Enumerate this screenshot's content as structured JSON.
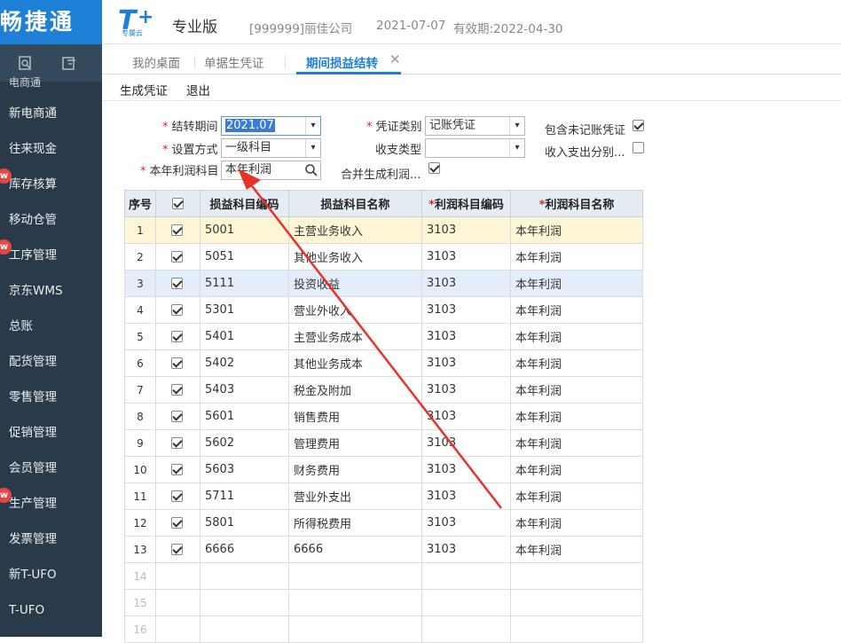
{
  "sidebar": {
    "logo": "畅捷通",
    "cut_item": "电商通",
    "items": [
      {
        "label": "新电商通",
        "badge": ""
      },
      {
        "label": "往来现金",
        "badge": ""
      },
      {
        "label": "库存核算",
        "badge": "w"
      },
      {
        "label": "移动仓管",
        "badge": ""
      },
      {
        "label": "工序管理",
        "badge": "w"
      },
      {
        "label": "京东WMS",
        "badge": ""
      },
      {
        "label": "总账",
        "badge": ""
      },
      {
        "label": "配货管理",
        "badge": ""
      },
      {
        "label": "零售管理",
        "badge": ""
      },
      {
        "label": "促销管理",
        "badge": ""
      },
      {
        "label": "会员管理",
        "badge": ""
      },
      {
        "label": "生产管理",
        "badge": "w"
      },
      {
        "label": "发票管理",
        "badge": ""
      },
      {
        "label": "新T-UFO",
        "badge": ""
      },
      {
        "label": "T-UFO",
        "badge": ""
      }
    ]
  },
  "header": {
    "brand_sub": "专属云",
    "brand_name": "专业版",
    "company": "[999999]丽佳公司",
    "date": "2021-07-07",
    "expire": "有效期:2022-04-30"
  },
  "tabs": [
    {
      "label": "我的桌面"
    },
    {
      "label": "单据生凭证"
    },
    {
      "label": "期间损益结转"
    }
  ],
  "toolbar": {
    "generate": "生成凭证",
    "exit": "退出"
  },
  "form": {
    "period_label": "结转期间",
    "period_value": "2021.07",
    "method_label": "设置方式",
    "method_value": "一级科目",
    "profit_label": "本年利润科目",
    "profit_value": "本年利润",
    "voucher_type_label": "凭证类别",
    "voucher_type_value": "记账凭证",
    "revenue_type_label": "收支类型",
    "revenue_type_value": "",
    "include_unposted_label": "包含未记账凭证",
    "include_unposted": true,
    "split_label": "收入支出分别...",
    "split": false,
    "merge_label": "合并生成利润...",
    "merge": true
  },
  "grid": {
    "headers": [
      "序号",
      "",
      "损益科目编码",
      "损益科目名称",
      "利润科目编码",
      "利润科目名称"
    ],
    "rows": [
      {
        "no": "1",
        "checked": true,
        "code": "5001",
        "name": "主营业务收入",
        "pcode": "3103",
        "pname": "本年利润"
      },
      {
        "no": "2",
        "checked": true,
        "code": "5051",
        "name": "其他业务收入",
        "pcode": "3103",
        "pname": "本年利润"
      },
      {
        "no": "3",
        "checked": true,
        "code": "5111",
        "name": "投资收益",
        "pcode": "3103",
        "pname": "本年利润"
      },
      {
        "no": "4",
        "checked": true,
        "code": "5301",
        "name": "营业外收入",
        "pcode": "3103",
        "pname": "本年利润"
      },
      {
        "no": "5",
        "checked": true,
        "code": "5401",
        "name": "主营业务成本",
        "pcode": "3103",
        "pname": "本年利润"
      },
      {
        "no": "6",
        "checked": true,
        "code": "5402",
        "name": "其他业务成本",
        "pcode": "3103",
        "pname": "本年利润"
      },
      {
        "no": "7",
        "checked": true,
        "code": "5403",
        "name": "税金及附加",
        "pcode": "3103",
        "pname": "本年利润"
      },
      {
        "no": "8",
        "checked": true,
        "code": "5601",
        "name": "销售费用",
        "pcode": "3103",
        "pname": "本年利润"
      },
      {
        "no": "9",
        "checked": true,
        "code": "5602",
        "name": "管理费用",
        "pcode": "3103",
        "pname": "本年利润"
      },
      {
        "no": "10",
        "checked": true,
        "code": "5603",
        "name": "财务费用",
        "pcode": "3103",
        "pname": "本年利润"
      },
      {
        "no": "11",
        "checked": true,
        "code": "5711",
        "name": "营业外支出",
        "pcode": "3103",
        "pname": "本年利润"
      },
      {
        "no": "12",
        "checked": true,
        "code": "5801",
        "name": "所得税费用",
        "pcode": "3103",
        "pname": "本年利润"
      },
      {
        "no": "13",
        "checked": true,
        "code": "6666",
        "name": "6666",
        "pcode": "3103",
        "pname": "本年利润"
      },
      {
        "no": "14",
        "checked": false,
        "code": "",
        "name": "",
        "pcode": "",
        "pname": ""
      },
      {
        "no": "15",
        "checked": false,
        "code": "",
        "name": "",
        "pcode": "",
        "pname": ""
      },
      {
        "no": "16",
        "checked": false,
        "code": "",
        "name": "",
        "pcode": "",
        "pname": ""
      }
    ]
  },
  "colors": {
    "accent": "#1e7fd6",
    "sidebar": "#2b3a4a",
    "annotation": "#e8322a"
  }
}
